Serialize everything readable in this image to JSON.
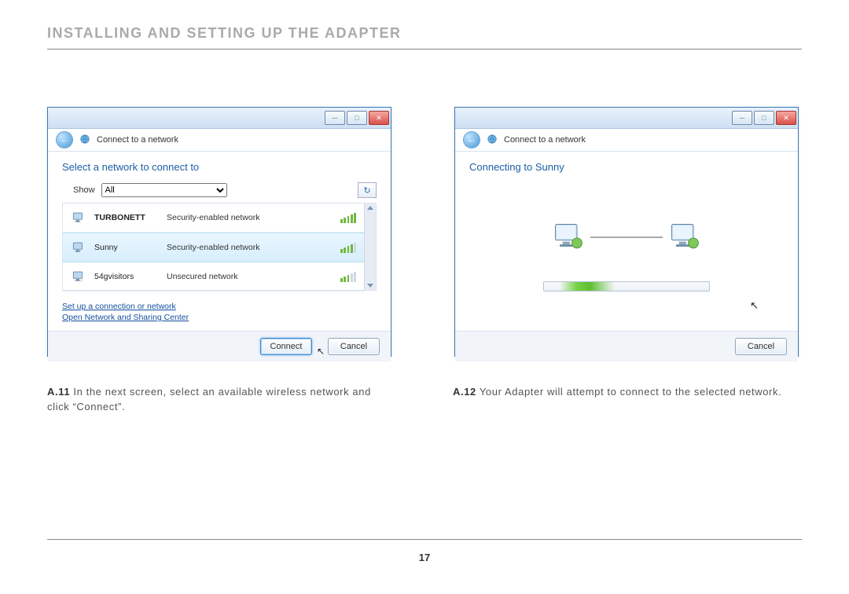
{
  "page": {
    "heading": "INSTALLING AND SETTING UP THE ADAPTER",
    "number": "17"
  },
  "win1": {
    "title": "Connect to a network",
    "headline": "Select a network to connect to",
    "show_label": "Show",
    "show_value": "All",
    "networks": [
      {
        "name": "TURBONETT",
        "desc": "Security-enabled network",
        "strength": 5,
        "secure": true,
        "bold": true
      },
      {
        "name": "Sunny",
        "desc": "Security-enabled network",
        "strength": 4,
        "secure": true,
        "selected": true
      },
      {
        "name": "54gvisitors",
        "desc": "Unsecured network",
        "strength": 3,
        "secure": false
      }
    ],
    "link_setup": "Set up a connection or network",
    "link_center": "Open Network and Sharing Center",
    "btn_connect": "Connect",
    "btn_cancel": "Cancel"
  },
  "win2": {
    "title": "Connect to a network",
    "headline": "Connecting to Sunny",
    "btn_cancel": "Cancel"
  },
  "captions": {
    "a11_num": "A.11",
    "a11_text": "In the next screen, select an available wireless network and click “Connect”.",
    "a12_num": "A.12",
    "a12_text": "Your Adapter will attempt to connect to the selected network."
  },
  "icons": {
    "back": "back-arrow-icon",
    "network": "network-icon",
    "refresh": "refresh-icon",
    "signal": "signal-bars-icon",
    "minimize": "minimize-icon",
    "maximize": "maximize-icon",
    "close": "close-icon",
    "monitor": "computer-monitor-icon",
    "cursor": "mouse-cursor-icon"
  }
}
